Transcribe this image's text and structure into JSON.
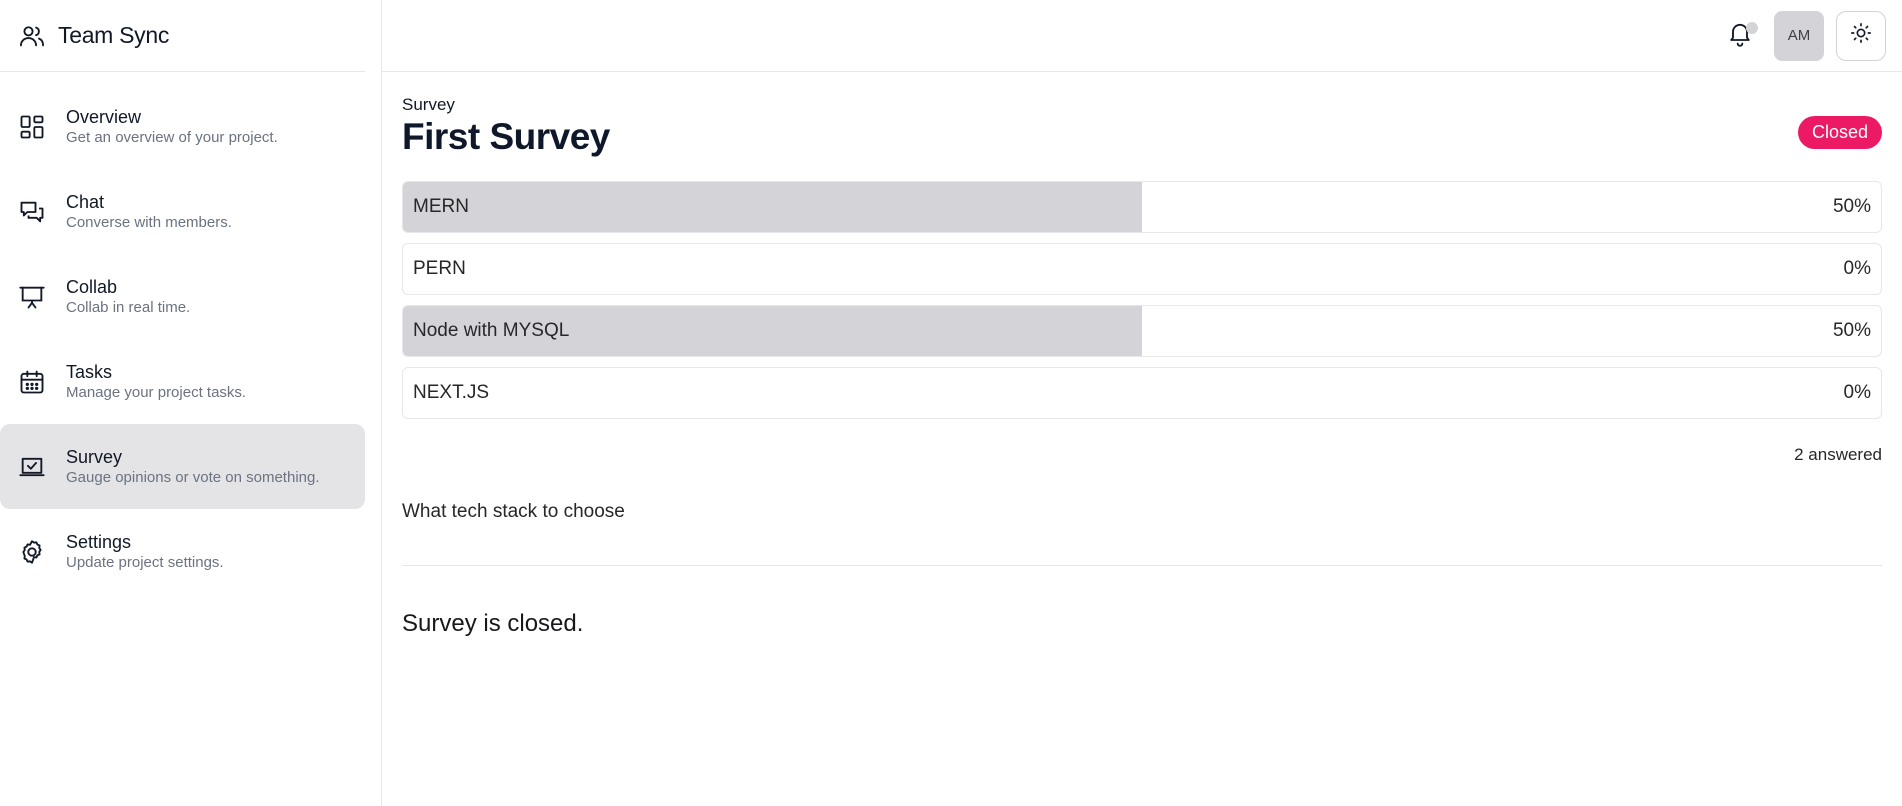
{
  "brand": {
    "name": "Team Sync",
    "icon": "users-icon"
  },
  "sidebar": {
    "items": [
      {
        "label": "Overview",
        "desc": "Get an overview of your project.",
        "icon": "dashboard-icon",
        "active": false
      },
      {
        "label": "Chat",
        "desc": "Converse with members.",
        "icon": "chat-icon",
        "active": false
      },
      {
        "label": "Collab",
        "desc": "Collab in real time.",
        "icon": "presentation-icon",
        "active": false
      },
      {
        "label": "Tasks",
        "desc": "Manage your project tasks.",
        "icon": "calendar-icon",
        "active": false
      },
      {
        "label": "Survey",
        "desc": "Gauge opinions or vote on something.",
        "icon": "survey-icon",
        "active": true
      },
      {
        "label": "Settings",
        "desc": "Update project settings.",
        "icon": "gear-icon",
        "active": false
      }
    ]
  },
  "topbar": {
    "avatar_initials": "AM",
    "bell_icon": "bell-icon",
    "theme_icon": "sun-icon"
  },
  "survey": {
    "eyebrow": "Survey",
    "title": "First Survey",
    "status": "Closed",
    "options": [
      {
        "label": "MERN",
        "percent": "50%",
        "fraction": 0.5
      },
      {
        "label": "PERN",
        "percent": "0%",
        "fraction": 0
      },
      {
        "label": "Node with MYSQL",
        "percent": "50%",
        "fraction": 0.5
      },
      {
        "label": "NEXT.JS",
        "percent": "0%",
        "fraction": 0
      }
    ],
    "answered": "2 answered",
    "question": "What tech stack to choose",
    "closed_message": "Survey is closed."
  },
  "colors": {
    "status_badge": "#ec1a65",
    "active_nav": "#e4e4e7",
    "bar_fill": "#d4d4d8"
  }
}
